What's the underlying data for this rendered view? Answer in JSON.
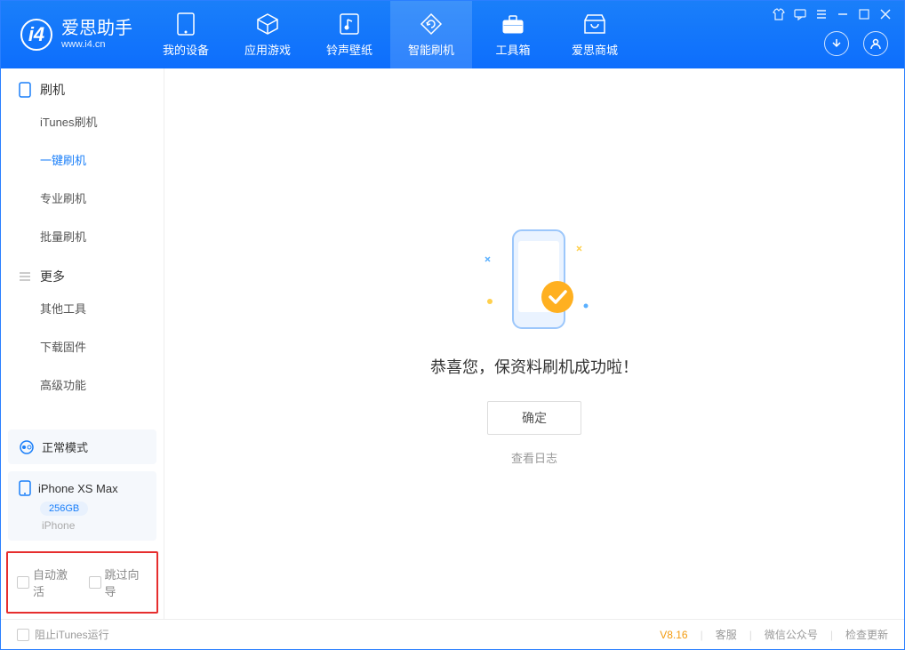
{
  "app": {
    "title": "爱思助手",
    "subtitle": "www.i4.cn"
  },
  "tabs": [
    {
      "label": "我的设备"
    },
    {
      "label": "应用游戏"
    },
    {
      "label": "铃声壁纸"
    },
    {
      "label": "智能刷机"
    },
    {
      "label": "工具箱"
    },
    {
      "label": "爱思商城"
    }
  ],
  "sidebar": {
    "group1": {
      "title": "刷机"
    },
    "items1": [
      {
        "label": "iTunes刷机"
      },
      {
        "label": "一键刷机"
      },
      {
        "label": "专业刷机"
      },
      {
        "label": "批量刷机"
      }
    ],
    "group2": {
      "title": "更多"
    },
    "items2": [
      {
        "label": "其他工具"
      },
      {
        "label": "下载固件"
      },
      {
        "label": "高级功能"
      }
    ],
    "mode": "正常模式",
    "device": {
      "name": "iPhone XS Max",
      "capacity": "256GB",
      "type": "iPhone"
    },
    "opt1": "自动激活",
    "opt2": "跳过向导"
  },
  "content": {
    "message": "恭喜您，保资料刷机成功啦！",
    "ok": "确定",
    "log": "查看日志"
  },
  "footer": {
    "block_itunes": "阻止iTunes运行",
    "version": "V8.16",
    "service": "客服",
    "wechat": "微信公众号",
    "update": "检查更新"
  }
}
